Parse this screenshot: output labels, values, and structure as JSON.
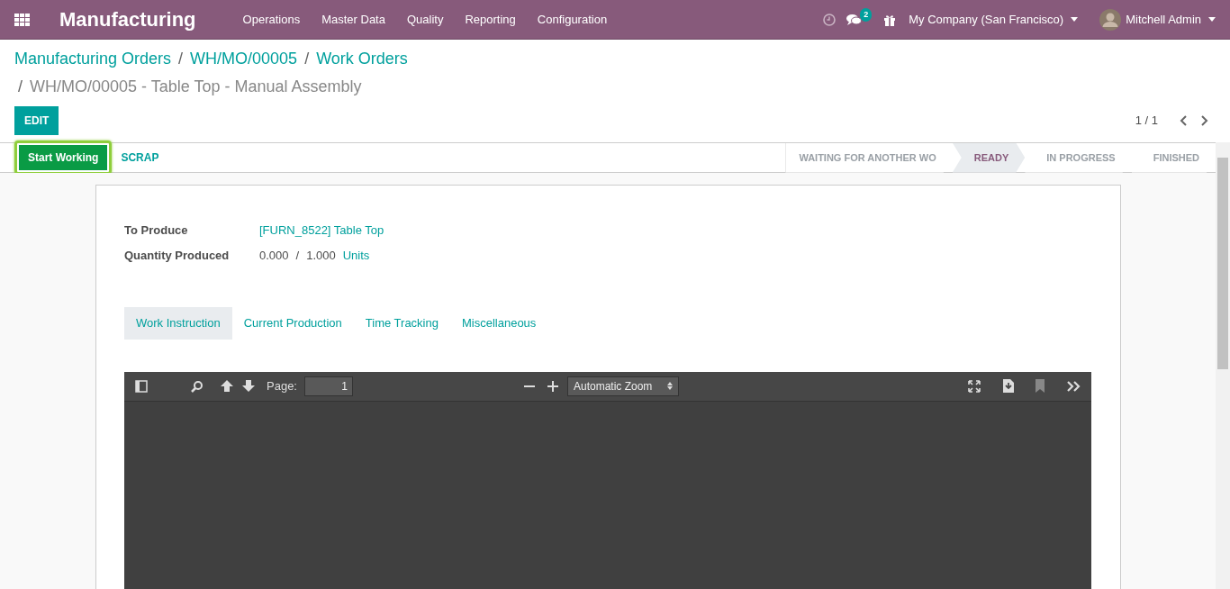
{
  "navbar": {
    "app_title": "Manufacturing",
    "menus": [
      "Operations",
      "Master Data",
      "Quality",
      "Reporting",
      "Configuration"
    ],
    "messages_badge": "2",
    "company": "My Company (San Francisco)",
    "user": "Mitchell Admin"
  },
  "breadcrumbs": [
    {
      "label": "Manufacturing Orders"
    },
    {
      "separator": "/",
      "label": "WH/MO/00005"
    },
    {
      "separator": "/",
      "label": "Work Orders"
    }
  ],
  "current_record": {
    "separator": "/",
    "label": "WH/MO/00005 - Table Top - Manual Assembly"
  },
  "edit_button": "EDIT",
  "pager": "1 / 1",
  "header_buttons": [
    {
      "label": "Start Working",
      "kind": "primary"
    },
    {
      "label": "SCRAP",
      "kind": "link"
    }
  ],
  "stages": [
    {
      "label": "WAITING FOR ANOTHER WO",
      "selected": false
    },
    {
      "label": "READY",
      "selected": true
    },
    {
      "label": "IN PROGRESS",
      "selected": false
    },
    {
      "label": "FINISHED",
      "selected": false
    }
  ],
  "fields": [
    {
      "label": "To Produce",
      "kind": "link",
      "value": "[FURN_8522] Table Top"
    },
    {
      "label": "Quantity Produced",
      "kind": "quantity",
      "produced": "0.000",
      "separator": "/",
      "total": "1.000",
      "unit": "Units"
    }
  ],
  "tabs": [
    {
      "label": "Work Instruction",
      "selected": true
    },
    {
      "label": "Current Production",
      "selected": false
    },
    {
      "label": "Time Tracking",
      "selected": false
    },
    {
      "label": "Miscellaneous",
      "selected": false
    }
  ],
  "pdf_viewer": {
    "page_label": "Page:",
    "page": "1",
    "zoom": "Automatic Zoom"
  }
}
